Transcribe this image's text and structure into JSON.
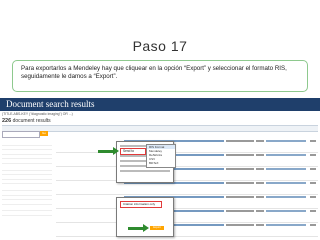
{
  "slide": {
    "title": "Paso 17",
    "callout": "Para exportarlos a Mendeley hay que cliquear en la opción “Export” y seleccionar el formato RIS, seguidamente le damos a “Export”."
  },
  "scopus": {
    "header": "Document search results",
    "search_line": "(TITLE-ABS-KEY (\"diagnostic imaging\") OR ...)",
    "docs_count": "226",
    "docs_label": "document results",
    "go_label": "Go",
    "send_to_label": "Send to",
    "submenu": [
      "RIS Format",
      "Mendeley",
      "RefWorks",
      "CSV",
      "BibTeX",
      "Text"
    ],
    "select_label": "Citation information only",
    "export_label": "Export"
  },
  "colors": {
    "header_bg": "#1f3f6b",
    "callout_border": "#8ec98e",
    "arrow": "#2e8b2e",
    "highlight": "#e13a3a"
  }
}
